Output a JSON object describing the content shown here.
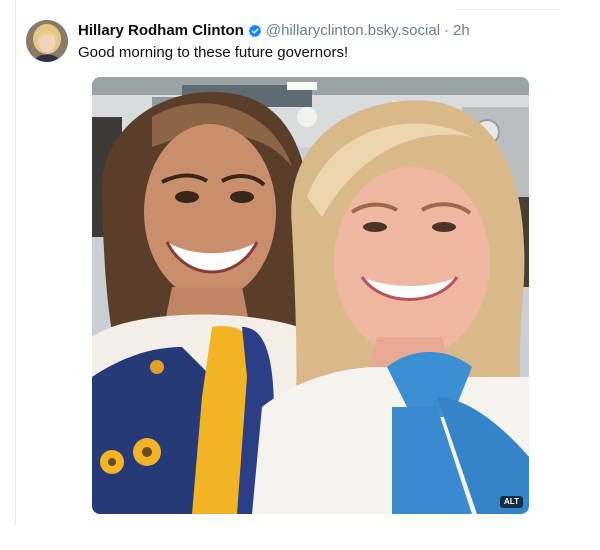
{
  "post": {
    "author_name": "Hillary Rodham Clinton",
    "handle": "@hillaryclinton.bsky.social",
    "separator": "·",
    "time": "2h",
    "text": "Good morning to these future governors!",
    "image_alt_badge": "ALT"
  },
  "icons": {
    "verified": "verified-check-icon",
    "avatar": "profile-avatar"
  },
  "colors": {
    "verified_blue": "#1185fe",
    "handle_gray": "#6f7c8e",
    "text": "#0b0f14"
  }
}
